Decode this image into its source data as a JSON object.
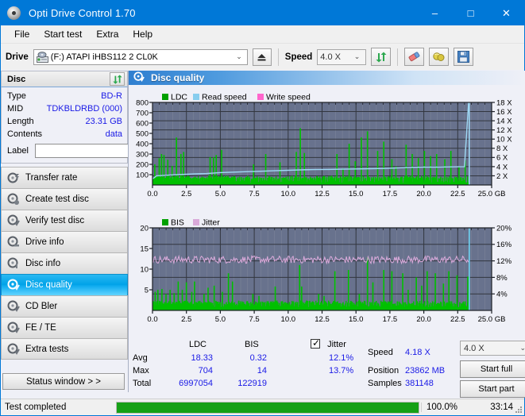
{
  "window": {
    "title": "Opti Drive Control 1.70",
    "icon": "disc-icon",
    "minimize": "–",
    "maximize": "□",
    "close": "✕"
  },
  "menu": {
    "items": [
      "File",
      "Start test",
      "Extra",
      "Help"
    ]
  },
  "toolbar": {
    "drive_label": "Drive",
    "drive_value": "(F:)  ATAPI iHBS112  2 CL0K",
    "eject_icon": "eject-icon",
    "speed_label": "Speed",
    "speed_value": "4.0 X",
    "refresh_icon": "refresh-icon",
    "eraser_icon": "eraser-icon",
    "bulb_icon": "bulb-icon",
    "save_icon": "save-icon"
  },
  "disc_panel": {
    "header": "Disc",
    "refresh_icon": "refresh-icon",
    "rows": [
      {
        "key": "Type",
        "value": "BD-R"
      },
      {
        "key": "MID",
        "value": "TDKBLDRBD (000)"
      },
      {
        "key": "Length",
        "value": "23.31 GB"
      },
      {
        "key": "Contents",
        "value": "data"
      }
    ],
    "label_key": "Label",
    "label_value": "",
    "label_placeholder": "",
    "label_button_icon": "cd-icon"
  },
  "sidebar": {
    "items": [
      {
        "label": "Transfer rate",
        "icon": "disc-transfer-icon",
        "active": false
      },
      {
        "label": "Create test disc",
        "icon": "disc-create-icon",
        "active": false
      },
      {
        "label": "Verify test disc",
        "icon": "disc-verify-icon",
        "active": false
      },
      {
        "label": "Drive info",
        "icon": "disc-drive-icon",
        "active": false
      },
      {
        "label": "Disc info",
        "icon": "disc-info-icon",
        "active": false
      },
      {
        "label": "Disc quality",
        "icon": "disc-quality-icon",
        "active": true
      },
      {
        "label": "CD Bler",
        "icon": "disc-bler-icon",
        "active": false
      },
      {
        "label": "FE / TE",
        "icon": "disc-fete-icon",
        "active": false
      },
      {
        "label": "Extra tests",
        "icon": "disc-extra-icon",
        "active": false
      }
    ],
    "status_window_button": "Status window > >"
  },
  "main": {
    "header_title": "Disc quality",
    "header_icon": "disc-quality-icon"
  },
  "stats": {
    "col_ldc": "LDC",
    "col_bis": "BIS",
    "row_avg": "Avg",
    "row_max": "Max",
    "row_total": "Total",
    "ldc_avg": "18.33",
    "ldc_max": "704",
    "ldc_total": "6997054",
    "bis_avg": "0.32",
    "bis_max": "14",
    "bis_total": "122919",
    "jitter_label": "Jitter",
    "jitter_checked": true,
    "jitter_avg": "12.1%",
    "jitter_max": "13.7%",
    "speed_label": "Speed",
    "speed_value": "4.18 X",
    "position_label": "Position",
    "position_value": "23862 MB",
    "samples_label": "Samples",
    "samples_value": "381148",
    "speed_select": "4.0 X",
    "start_full": "Start full",
    "start_part": "Start part"
  },
  "statusbar": {
    "message": "Test completed",
    "progress_pct_text": "100.0%",
    "progress_value": 100,
    "elapsed": "33:14"
  },
  "chart_data": [
    {
      "type": "bar",
      "id": "ldc-chart",
      "title": "",
      "legend": [
        {
          "label": "LDC",
          "color": "#00a000"
        },
        {
          "label": "Read speed",
          "color": "#87cdee"
        },
        {
          "label": "Write speed",
          "color": "#ff66cc"
        }
      ],
      "legend_position": "top-left",
      "xlabel": "GB",
      "ylabel": "",
      "xlim": [
        0,
        25.0
      ],
      "ylim": [
        0,
        800
      ],
      "y2lim": [
        0,
        18
      ],
      "y2label": "X",
      "xticks": [
        0.0,
        2.5,
        5.0,
        7.5,
        10.0,
        12.5,
        15.0,
        17.5,
        20.0,
        22.5,
        25.0
      ],
      "xticklabels": [
        "0.0",
        "2.5",
        "5.0",
        "7.5",
        "10.0",
        "12.5",
        "15.0",
        "17.5",
        "20.0",
        "22.5",
        "25.0 GB"
      ],
      "yticks": [
        100,
        200,
        300,
        400,
        500,
        600,
        700,
        800
      ],
      "y2ticks": [
        2,
        4,
        6,
        8,
        10,
        12,
        14,
        16,
        18
      ],
      "y2ticklabels": [
        "2 X",
        "4 X",
        "6 X",
        "8 X",
        "10 X",
        "12 X",
        "14 X",
        "16 X",
        "18 X"
      ],
      "grid": true,
      "plot_bg": "#68728d",
      "data_end_x": 23.35,
      "series": [
        {
          "name": "LDC",
          "color": "#00c000",
          "x": [
            0.05,
            0.12,
            0.2,
            0.28,
            0.36,
            0.45,
            0.55,
            0.62,
            0.7,
            0.8,
            0.9,
            1.0,
            1.08,
            1.18,
            1.3,
            1.4,
            1.5,
            1.62,
            1.72,
            1.84,
            1.95,
            2.05,
            2.15,
            2.25,
            2.35,
            2.45,
            2.55,
            2.65,
            2.78,
            2.9,
            3.0,
            3.1,
            3.2,
            3.3,
            3.4,
            3.5,
            3.6,
            3.7,
            3.8,
            3.9,
            4.0,
            4.1,
            4.2,
            4.32,
            4.45,
            4.55,
            4.65,
            4.75,
            4.85,
            4.95,
            5.05,
            5.15,
            5.25,
            5.35,
            5.45,
            5.55,
            5.65,
            5.75,
            5.85,
            5.95,
            6.05,
            6.2,
            6.35,
            6.5,
            6.65,
            6.8,
            6.95,
            7.1,
            7.25,
            7.4,
            7.55,
            7.7,
            7.85,
            8.0,
            8.15,
            8.3,
            8.45,
            8.6,
            8.75,
            8.9,
            9.05,
            9.2,
            9.35,
            9.5,
            9.65,
            9.8,
            9.95,
            10.1,
            10.25,
            10.4,
            10.55,
            10.7,
            10.85,
            11.0,
            11.15,
            11.3,
            11.45,
            11.6,
            11.75,
            11.9,
            12.05,
            12.2,
            12.35,
            12.5,
            12.65,
            12.8,
            12.95,
            13.1,
            13.25,
            13.4,
            13.55,
            13.7,
            13.85,
            14.0,
            14.15,
            14.3,
            14.45,
            14.6,
            14.75,
            14.9,
            15.05,
            15.2,
            15.35,
            15.5,
            15.65,
            15.8,
            15.95,
            16.1,
            16.25,
            16.4,
            16.55,
            16.7,
            16.85,
            17.0,
            17.15,
            17.3,
            17.45,
            17.6,
            17.75,
            17.9,
            18.05,
            18.2,
            18.35,
            18.5,
            18.65,
            18.8,
            18.95,
            19.1,
            19.25,
            19.4,
            19.55,
            19.7,
            19.85,
            20.0,
            20.15,
            20.3,
            20.45,
            20.6,
            20.75,
            20.9,
            21.05,
            21.2,
            21.35,
            21.5,
            21.65,
            21.8,
            21.95,
            22.1,
            22.25,
            22.4,
            22.55,
            22.7,
            22.85,
            23.0,
            23.15,
            23.3
          ],
          "y": [
            60,
            200,
            70,
            90,
            75,
            260,
            70,
            300,
            80,
            290,
            70,
            85,
            245,
            90,
            75,
            185,
            60,
            80,
            460,
            95,
            70,
            300,
            85,
            320,
            70,
            80,
            90,
            85,
            70,
            60,
            75,
            80,
            70,
            65,
            60,
            70,
            80,
            75,
            70,
            65,
            60,
            90,
            270,
            80,
            270,
            85,
            290,
            70,
            80,
            75,
            340,
            85,
            70,
            90,
            65,
            80,
            70,
            60,
            75,
            85,
            70,
            65,
            60,
            75,
            70,
            65,
            80,
            70,
            60,
            200,
            70,
            65,
            75,
            70,
            60,
            300,
            70,
            80,
            65,
            70,
            75,
            60,
            220,
            70,
            65,
            80,
            70,
            60,
            75,
            70,
            320,
            80,
            550,
            70,
            310,
            75,
            65,
            80,
            70,
            75,
            60,
            70,
            65,
            80,
            70,
            75,
            60,
            70,
            65,
            80,
            300,
            70,
            65,
            160,
            75,
            70,
            400,
            80,
            65,
            230,
            75,
            70,
            460,
            85,
            70,
            520,
            75,
            65,
            80,
            70,
            330,
            75,
            70,
            420,
            65,
            80,
            70,
            250,
            75,
            180,
            70,
            65,
            80,
            70,
            390,
            75,
            70,
            300,
            65,
            80,
            260,
            70,
            75,
            330,
            70,
            65,
            280,
            75,
            70,
            300,
            65,
            80,
            70,
            250,
            75,
            70,
            330,
            65,
            80,
            70,
            180,
            75,
            70,
            240
          ]
        },
        {
          "name": "Read speed",
          "color": "#9fd9f5",
          "axis": "y2",
          "x": [
            0.0,
            0.3,
            0.8,
            1.5,
            2.2,
            3.0,
            4.0,
            5.0,
            6.0,
            7.0,
            8.0,
            9.0,
            10.0,
            11.0,
            12.0,
            13.0,
            14.0,
            15.0,
            16.0,
            17.0,
            18.0,
            19.0,
            20.0,
            21.0,
            22.0,
            23.0,
            23.3
          ],
          "y": [
            1.3,
            2.0,
            2.1,
            2.2,
            2.3,
            2.4,
            2.5,
            2.7,
            2.8,
            2.9,
            3.0,
            3.1,
            3.2,
            3.3,
            3.35,
            3.4,
            3.45,
            3.5,
            3.55,
            3.6,
            3.7,
            3.85,
            3.9,
            3.9,
            3.95,
            4.0,
            18.0
          ]
        }
      ]
    },
    {
      "type": "bar",
      "id": "bis-jitter-chart",
      "title": "",
      "legend": [
        {
          "label": "BIS",
          "color": "#00a000"
        },
        {
          "label": "Jitter",
          "color": "#d9a9d9"
        }
      ],
      "legend_position": "top-left",
      "xlabel": "GB",
      "ylabel": "",
      "xlim": [
        0,
        25.0
      ],
      "ylim": [
        0,
        20
      ],
      "y2lim": [
        0,
        20
      ],
      "y2label": "%",
      "xticks": [
        0.0,
        2.5,
        5.0,
        7.5,
        10.0,
        12.5,
        15.0,
        17.5,
        20.0,
        22.5,
        25.0
      ],
      "xticklabels": [
        "0.0",
        "2.5",
        "5.0",
        "7.5",
        "10.0",
        "12.5",
        "15.0",
        "17.5",
        "20.0",
        "22.5",
        "25.0 GB"
      ],
      "yticks": [
        5,
        10,
        15,
        20
      ],
      "y2ticks": [
        4,
        8,
        12,
        16,
        20
      ],
      "y2ticklabels": [
        "4%",
        "8%",
        "12%",
        "16%",
        "20%"
      ],
      "grid": true,
      "plot_bg": "#68728d",
      "data_end_x": 23.35,
      "series": [
        {
          "name": "BIS",
          "color": "#00c000",
          "x": [
            0.05,
            0.15,
            0.25,
            0.35,
            0.45,
            0.55,
            0.65,
            0.75,
            0.85,
            0.95,
            1.05,
            1.15,
            1.25,
            1.35,
            1.45,
            1.55,
            1.65,
            1.75,
            1.85,
            1.95,
            2.05,
            2.15,
            2.25,
            2.35,
            2.45,
            2.55,
            2.65,
            2.75,
            2.85,
            2.95,
            3.05,
            3.15,
            3.25,
            3.35,
            3.45,
            3.55,
            3.65,
            3.75,
            3.85,
            3.95,
            4.05,
            4.2,
            4.35,
            4.5,
            4.65,
            4.8,
            4.95,
            5.1,
            5.25,
            5.4,
            5.55,
            5.7,
            5.85,
            6.0,
            6.15,
            6.3,
            6.45,
            6.6,
            6.75,
            6.9,
            7.05,
            7.2,
            7.35,
            7.5,
            7.65,
            7.8,
            7.95,
            8.1,
            8.25,
            8.4,
            8.55,
            8.7,
            8.85,
            9.0,
            9.15,
            9.3,
            9.45,
            9.6,
            9.75,
            9.9,
            10.05,
            10.2,
            10.35,
            10.5,
            10.65,
            10.8,
            10.95,
            11.1,
            11.25,
            11.4,
            11.55,
            11.7,
            11.85,
            12.0,
            12.2,
            12.4,
            12.6,
            12.8,
            13.0,
            13.2,
            13.4,
            13.6,
            13.8,
            14.0,
            14.2,
            14.4,
            14.6,
            14.8,
            15.0,
            15.2,
            15.4,
            15.6,
            15.8,
            16.0,
            16.2,
            16.4,
            16.6,
            16.8,
            17.0,
            17.2,
            17.4,
            17.6,
            17.8,
            18.0,
            18.2,
            18.4,
            18.6,
            18.8,
            19.0,
            19.2,
            19.4,
            19.6,
            19.8,
            20.0,
            20.2,
            20.4,
            20.6,
            20.8,
            21.0,
            21.2,
            21.4,
            21.6,
            21.8,
            22.0,
            22.2,
            22.4,
            22.6,
            22.8,
            23.0,
            23.2,
            23.3
          ],
          "y": [
            1.5,
            4.5,
            2.0,
            5.0,
            1.8,
            2.2,
            5.2,
            1.6,
            2.0,
            4.0,
            1.8,
            2.2,
            5.0,
            1.6,
            2.0,
            4.2,
            1.8,
            2.0,
            7.0,
            2.2,
            1.8,
            5.0,
            2.0,
            1.6,
            6.8,
            2.2,
            1.8,
            2.0,
            4.5,
            1.6,
            7.0,
            2.0,
            1.8,
            2.2,
            1.6,
            2.0,
            1.8,
            4.0,
            2.0,
            1.6,
            5.5,
            2.0,
            1.8,
            6.0,
            2.2,
            1.8,
            2.0,
            4.5,
            1.6,
            2.0,
            9.0,
            1.8,
            7.0,
            2.0,
            1.6,
            2.2,
            1.8,
            2.0,
            1.6,
            2.2,
            1.8,
            2.0,
            4.0,
            1.6,
            2.0,
            3.5,
            1.8,
            2.0,
            1.6,
            2.2,
            1.8,
            2.0,
            1.6,
            5.8,
            2.0,
            1.8,
            2.2,
            1.6,
            2.0,
            1.8,
            2.0,
            1.6,
            2.2,
            1.8,
            2.0,
            11.0,
            5.8,
            1.8,
            2.0,
            1.6,
            2.2,
            1.8,
            2.0,
            1.6,
            4.0,
            2.0,
            3.5,
            1.8,
            2.0,
            1.6,
            9.5,
            2.2,
            1.8,
            2.0,
            1.6,
            9.8,
            2.2,
            1.8,
            2.0,
            4.0,
            1.6,
            2.2,
            12.8,
            1.8,
            6.8,
            2.0,
            1.6,
            2.2,
            9.8,
            1.8,
            2.0,
            9.5,
            1.6,
            2.2,
            1.8,
            9.0,
            2.0,
            5.0,
            1.6,
            2.2,
            8.0,
            1.8,
            6.0,
            2.0,
            9.5,
            1.6,
            2.2,
            9.0,
            1.8,
            2.0,
            6.5,
            1.6,
            9.5,
            2.2,
            1.8,
            8.5,
            2.0,
            1.6,
            2.2,
            8.2,
            1.8,
            5.0,
            2.0
          ]
        },
        {
          "name": "Jitter",
          "color": "#dcabdc",
          "axis": "y2",
          "mean": 12.3,
          "noise": 0.9,
          "x_start": 0.05,
          "x_end": 23.3
        }
      ]
    }
  ]
}
